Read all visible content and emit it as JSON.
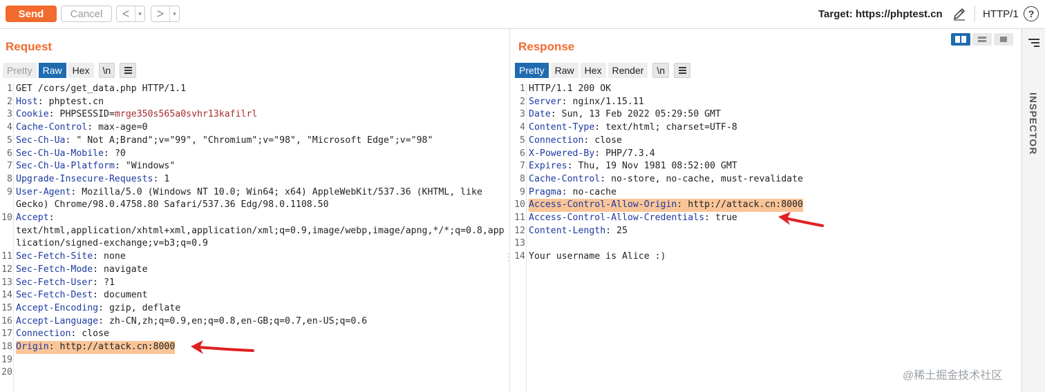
{
  "toolbar": {
    "send": "Send",
    "cancel": "Cancel",
    "back": "<",
    "forward": ">",
    "dropdown": "▾",
    "target": "Target: https://phptest.cn",
    "http_version": "HTTP/1",
    "help": "?"
  },
  "request": {
    "title": "Request",
    "tabs": [
      "Pretty",
      "Raw",
      "Hex",
      "\\n"
    ],
    "active_tab": "Raw",
    "lines": [
      {
        "n": "1",
        "text": "GET /cors/get_data.php HTTP/1.1"
      },
      {
        "n": "2",
        "key": "Host",
        "value": " phptest.cn"
      },
      {
        "n": "3",
        "key": "Cookie",
        "value": " PHPSESSID=",
        "cookie": "mrge350s565a0svhr13kafilrl"
      },
      {
        "n": "4",
        "key": "Cache-Control",
        "value": " max-age=0"
      },
      {
        "n": "5",
        "key": "Sec-Ch-Ua",
        "value": " \" Not A;Brand\";v=\"99\", \"Chromium\";v=\"98\", \"Microsoft Edge\";v=\"98\""
      },
      {
        "n": "6",
        "key": "Sec-Ch-Ua-Mobile",
        "value": " ?0"
      },
      {
        "n": "7",
        "key": "Sec-Ch-Ua-Platform",
        "value": " \"Windows\""
      },
      {
        "n": "8",
        "key": "Upgrade-Insecure-Requests",
        "value": " 1"
      },
      {
        "n": "9",
        "key": "User-Agent",
        "value": " Mozilla/5.0 (Windows NT 10.0; Win64; x64) AppleWebKit/537.36 (KHTML, like"
      },
      {
        "n": "",
        "text": "Gecko) Chrome/98.0.4758.80 Safari/537.36 Edg/98.0.1108.50"
      },
      {
        "n": "10",
        "key": "Accept",
        "value": ""
      },
      {
        "n": "",
        "text": "text/html,application/xhtml+xml,application/xml;q=0.9,image/webp,image/apng,*/*;q=0.8,app"
      },
      {
        "n": "",
        "text": "lication/signed-exchange;v=b3;q=0.9"
      },
      {
        "n": "11",
        "key": "Sec-Fetch-Site",
        "value": " none"
      },
      {
        "n": "12",
        "key": "Sec-Fetch-Mode",
        "value": " navigate"
      },
      {
        "n": "13",
        "key": "Sec-Fetch-User",
        "value": " ?1"
      },
      {
        "n": "14",
        "key": "Sec-Fetch-Dest",
        "value": " document"
      },
      {
        "n": "15",
        "key": "Accept-Encoding",
        "value": " gzip, deflate"
      },
      {
        "n": "16",
        "key": "Accept-Language",
        "value": " zh-CN,zh;q=0.9,en;q=0.8,en-GB;q=0.7,en-US;q=0.6"
      },
      {
        "n": "17",
        "key": "Connection",
        "value": " close"
      },
      {
        "n": "18",
        "key": "Origin",
        "value": " http://attack.cn:8000",
        "highlight": true
      },
      {
        "n": "19",
        "text": ""
      },
      {
        "n": "20",
        "text": ""
      }
    ]
  },
  "response": {
    "title": "Response",
    "tabs": [
      "Pretty",
      "Raw",
      "Hex",
      "Render",
      "\\n"
    ],
    "active_tab": "Pretty",
    "lines": [
      {
        "n": "1",
        "text": "HTTP/1.1 200 OK"
      },
      {
        "n": "2",
        "key": "Server",
        "value": " nginx/1.15.11"
      },
      {
        "n": "3",
        "key": "Date",
        "value": " Sun, 13 Feb 2022 05:29:50 GMT"
      },
      {
        "n": "4",
        "key": "Content-Type",
        "value": " text/html; charset=UTF-8"
      },
      {
        "n": "5",
        "key": "Connection",
        "value": " close"
      },
      {
        "n": "6",
        "key": "X-Powered-By",
        "value": " PHP/7.3.4"
      },
      {
        "n": "7",
        "key": "Expires",
        "value": " Thu, 19 Nov 1981 08:52:00 GMT"
      },
      {
        "n": "8",
        "key": "Cache-Control",
        "value": " no-store, no-cache, must-revalidate"
      },
      {
        "n": "9",
        "key": "Pragma",
        "value": " no-cache"
      },
      {
        "n": "10",
        "key": "Access-Control-Allow-Origin",
        "value": " http://attack.cn:8000",
        "highlight": true
      },
      {
        "n": "11",
        "key": "Access-Control-Allow-Credentials",
        "value": " true"
      },
      {
        "n": "12",
        "key": "Content-Length",
        "value": " 25"
      },
      {
        "n": "13",
        "text": ""
      },
      {
        "n": "14",
        "text": "Your username is Alice :)"
      }
    ]
  },
  "inspector": {
    "label": "INSPECTOR"
  },
  "watermark": "@稀土掘金技术社区",
  "colors": {
    "accent": "#f26a2d",
    "tab_active": "#1f6bb0",
    "header_key": "#1c3aa0",
    "highlight": "#f9c598",
    "arrow": "#e02020"
  }
}
